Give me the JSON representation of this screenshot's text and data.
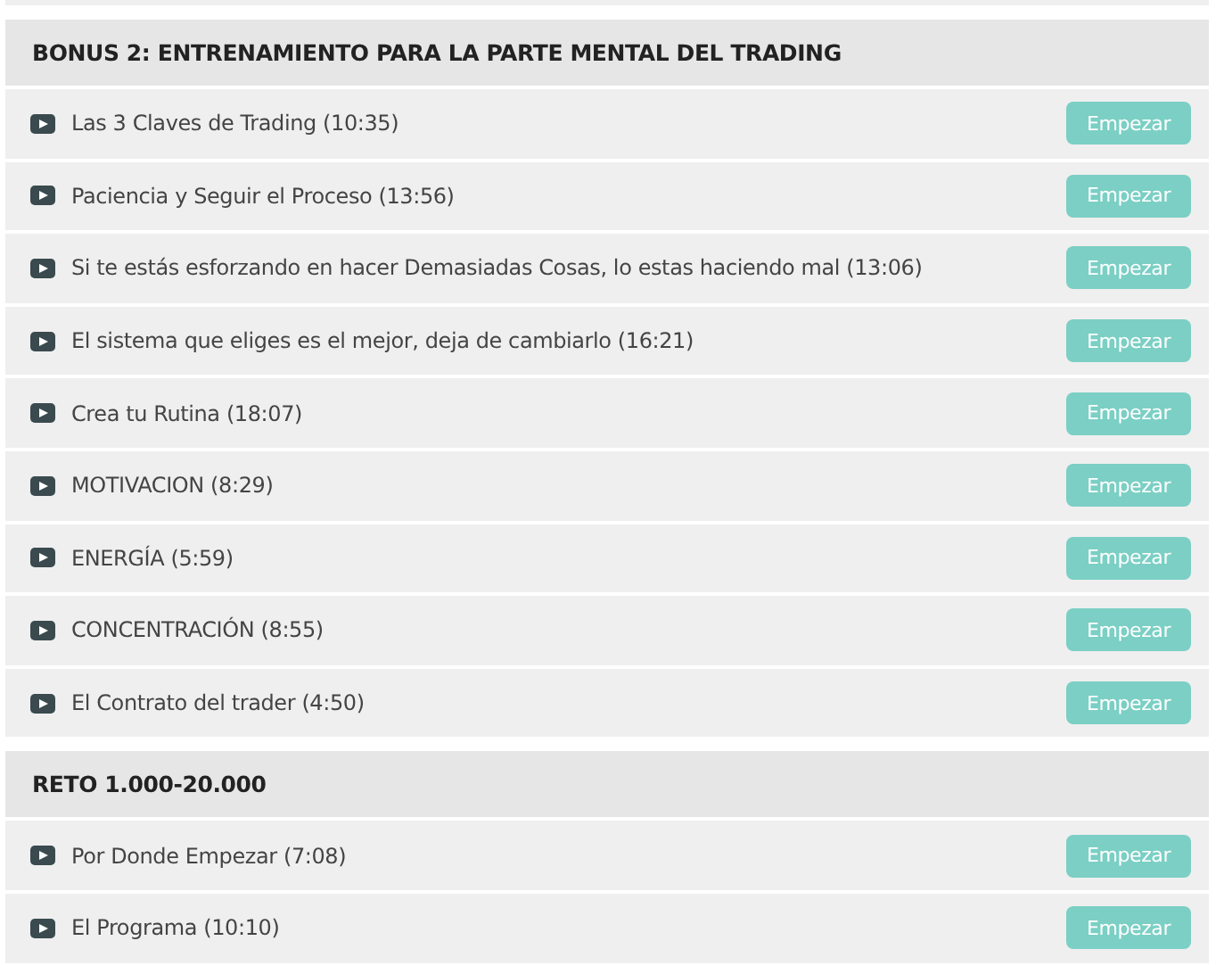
{
  "sections": [
    {
      "title": "BONUS 2: ENTRENAMIENTO PARA LA PARTE MENTAL DEL TRADING",
      "lessons": [
        {
          "title": "Las 3 Claves de Trading (10:35)",
          "button": "Empezar"
        },
        {
          "title": "Paciencia y Seguir el Proceso (13:56)",
          "button": "Empezar"
        },
        {
          "title": "Si te estás esforzando en hacer Demasiadas Cosas, lo estas haciendo mal (13:06)",
          "button": "Empezar"
        },
        {
          "title": "El sistema que eliges es el mejor, deja de cambiarlo (16:21)",
          "button": "Empezar"
        },
        {
          "title": "Crea tu Rutina (18:07)",
          "button": "Empezar"
        },
        {
          "title": "MOTIVACION (8:29)",
          "button": "Empezar"
        },
        {
          "title": "ENERGÍA (5:59)",
          "button": "Empezar"
        },
        {
          "title": "CONCENTRACIÓN (8:55)",
          "button": "Empezar"
        },
        {
          "title": "El Contrato del trader (4:50)",
          "button": "Empezar"
        }
      ]
    },
    {
      "title": "RETO 1.000-20.000",
      "lessons": [
        {
          "title": "Por Donde Empezar (7:08)",
          "button": "Empezar"
        },
        {
          "title": "El Programa (10:10)",
          "button": "Empezar"
        }
      ]
    }
  ]
}
